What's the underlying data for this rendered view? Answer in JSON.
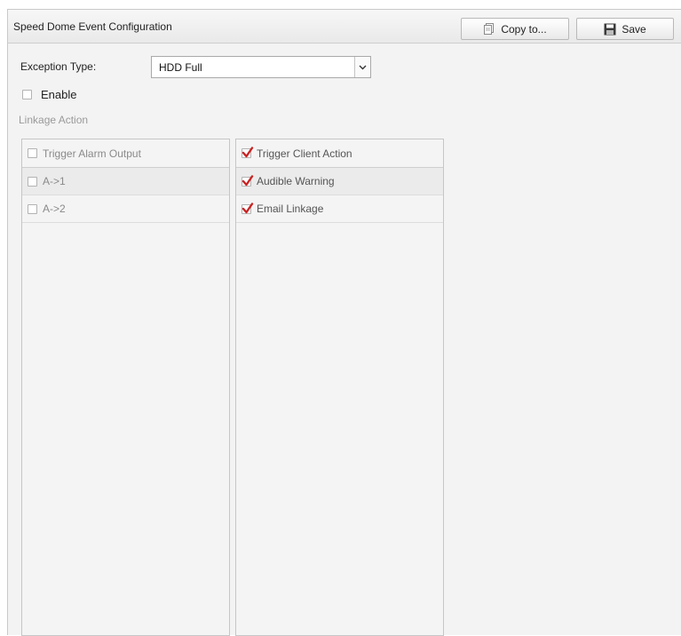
{
  "header": {
    "title": "Speed Dome Event Configuration",
    "copy_label": "Copy to...",
    "save_label": "Save"
  },
  "exception": {
    "label": "Exception Type:",
    "selected": "HDD Full"
  },
  "enable": {
    "label": "Enable",
    "checked": false
  },
  "linkage": {
    "title": "Linkage Action",
    "alarm_output": {
      "header_label": "Trigger Alarm Output",
      "header_checked": false,
      "items": [
        {
          "label": "A->1",
          "checked": false
        },
        {
          "label": "A->2",
          "checked": false
        }
      ]
    },
    "client_action": {
      "header_label": "Trigger Client Action",
      "header_checked": true,
      "items": [
        {
          "label": "Audible Warning",
          "checked": true
        },
        {
          "label": "Email Linkage",
          "checked": true
        }
      ]
    }
  },
  "colors": {
    "check_mark": "#cc2222",
    "panel_bg": "#f4f4f4",
    "muted_text": "#9a9a9a"
  }
}
